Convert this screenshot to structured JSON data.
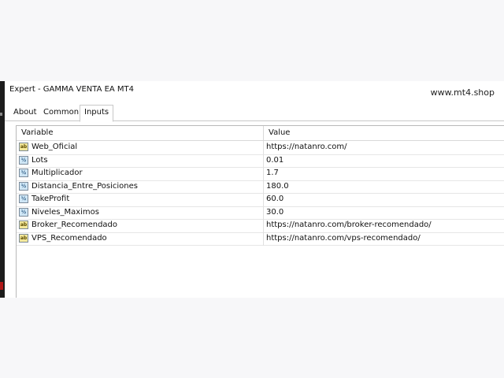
{
  "window": {
    "title": "Expert - GAMMA VENTA EA MT4"
  },
  "watermark": "www.mt4.shop",
  "tabs": [
    {
      "label": "About",
      "active": false
    },
    {
      "label": "Common",
      "active": false
    },
    {
      "label": "Inputs",
      "active": true
    }
  ],
  "table": {
    "columns": {
      "variable": "Variable",
      "value": "Value"
    },
    "rows": [
      {
        "type": "ab",
        "icon": "ab",
        "variable": "Web_Oficial",
        "value": "https://natanro.com/"
      },
      {
        "type": "num",
        "icon": "½",
        "variable": "Lots",
        "value": "0.01"
      },
      {
        "type": "num",
        "icon": "½",
        "variable": "Multiplicador",
        "value": "1.7"
      },
      {
        "type": "num",
        "icon": "½",
        "variable": "Distancia_Entre_Posiciones",
        "value": "180.0"
      },
      {
        "type": "num",
        "icon": "½",
        "variable": "TakeProfit",
        "value": "60.0"
      },
      {
        "type": "num",
        "icon": "½",
        "variable": "Niveles_Maximos",
        "value": "30.0"
      },
      {
        "type": "ab",
        "icon": "ab",
        "variable": "Broker_Recomendado",
        "value": "https://natanro.com/broker-recomendado/"
      },
      {
        "type": "ab",
        "icon": "ab",
        "variable": "VPS_Recomendado",
        "value": "https://natanro.com/vps-recomendado/"
      }
    ]
  }
}
